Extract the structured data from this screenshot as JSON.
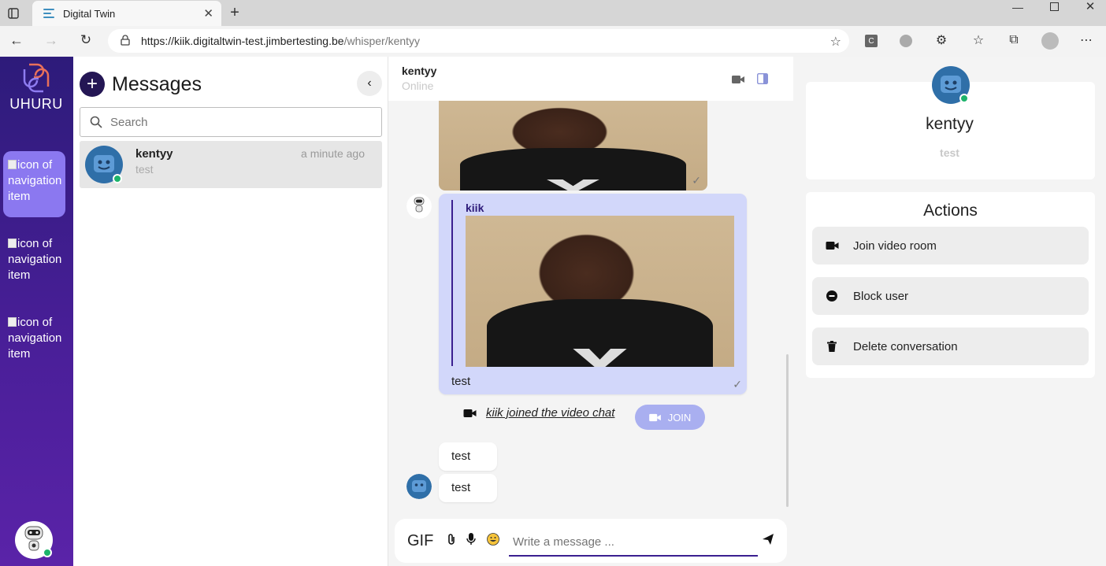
{
  "browser": {
    "tab_title": "Digital Twin",
    "url_host": "https://kiik.digitaltwin-test.jimbertesting.be",
    "url_path": "/whisper/kentyy"
  },
  "nav": {
    "brand": "UHURU",
    "items": [
      {
        "alt": "icon of navigation item"
      },
      {
        "alt": "icon of navigation item"
      },
      {
        "alt": "icon of navigation item"
      }
    ]
  },
  "messages": {
    "title": "Messages",
    "search_placeholder": "Search",
    "conversation": {
      "name": "kentyy",
      "time": "a minute ago",
      "preview": "test"
    }
  },
  "chat": {
    "name": "kentyy",
    "status": "Online",
    "reply_author": "kiik",
    "reply_text": "test",
    "system_text": "kiik joined the video chat",
    "join_label": "JOIN",
    "msg1": "test",
    "msg2": "test",
    "composer_placeholder": "Write a message ...",
    "gif_label": "GIF"
  },
  "profile": {
    "name": "kentyy",
    "status": "test"
  },
  "actions": {
    "title": "Actions",
    "items": [
      {
        "label": "Join video room",
        "icon": "video-icon"
      },
      {
        "label": "Block user",
        "icon": "block-icon"
      },
      {
        "label": "Delete conversation",
        "icon": "trash-icon"
      }
    ]
  },
  "colors": {
    "accent": "#241654",
    "sidebar": "#4b1f9a",
    "online": "#1db36b",
    "reply_bg": "#d2d7fa"
  }
}
